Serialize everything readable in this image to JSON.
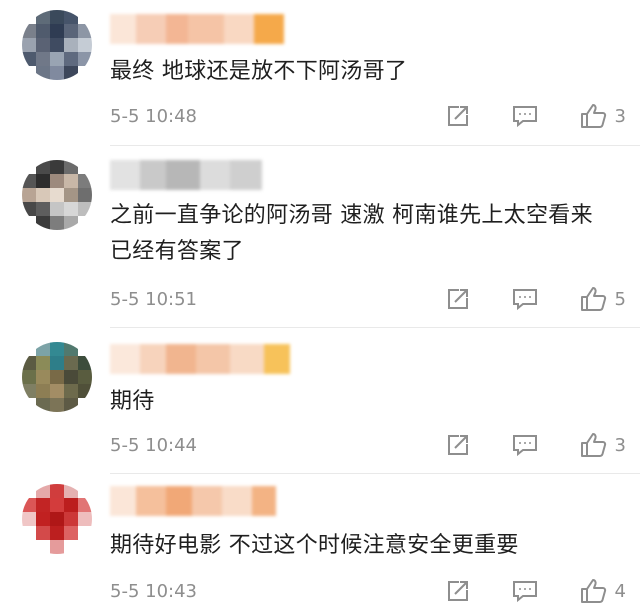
{
  "comments": [
    {
      "text": "最终 地球还是放不下阿汤哥了",
      "time": "5-5 10:48",
      "likes": "3",
      "avatar_colors": [
        "#ffffff",
        "#5d6b79",
        "#39495c",
        "#45546b",
        "#ffffff",
        "#7a808c",
        "#4f5b6e",
        "#2e3c54",
        "#59657a",
        "#8d96a6",
        "#9aa2b0",
        "#5a6275",
        "#3e4b62",
        "#a9b1bd",
        "#c5ccd5",
        "#4d5a6f",
        "#707889",
        "#99a4b4",
        "#5e6a80",
        "#8a95a8",
        "#ffffff",
        "#6c7688",
        "#7f8aa0",
        "#3d475c",
        "#ffffff"
      ],
      "name_colors": [
        "#fbe6d8",
        "#f6cdb6",
        "#f3b694",
        "#f5c4a6",
        "#f9d8c2",
        "#f5a94a"
      ]
    },
    {
      "text": "之前一直争论的阿汤哥 速激 柯南谁先上太空看来已经有答案了",
      "time": "5-5 10:51",
      "likes": "5",
      "avatar_colors": [
        "#ffffff",
        "#4a4a4a",
        "#3a3a3a",
        "#6b6b6b",
        "#ffffff",
        "#555555",
        "#2d2d2d",
        "#9e8a7c",
        "#c9b7a6",
        "#7c7c7c",
        "#b9a493",
        "#d9c8b7",
        "#e8dbce",
        "#a59585",
        "#6e6e6e",
        "#484848",
        "#5e5e5e",
        "#c5c5c5",
        "#d7d7d7",
        "#bdbdbd",
        "#ffffff",
        "#3b3b3b",
        "#7d7d7d",
        "#a9a9a9",
        "#ffffff"
      ],
      "name_colors": [
        "#e2e2e2",
        "#c9c9c9",
        "#b7b7b7",
        "#dcdcdc",
        "#cfcfcf"
      ]
    },
    {
      "text": "期待",
      "time": "5-5 10:44",
      "likes": "3",
      "avatar_colors": [
        "#ffffff",
        "#7aa3a8",
        "#2f8a93",
        "#4f7a6e",
        "#ffffff",
        "#5b5b42",
        "#8b8b55",
        "#2b7f8a",
        "#6a6a4e",
        "#3c4d3b",
        "#6b7048",
        "#9a8a5a",
        "#7a6a45",
        "#4a4a38",
        "#595c3e",
        "#7f7f62",
        "#8e7e52",
        "#a48d63",
        "#6d6a4a",
        "#505038",
        "#ffffff",
        "#6b6a50",
        "#7c7456",
        "#5d5a44",
        "#ffffff"
      ],
      "name_colors": [
        "#fbe8db",
        "#f7d3bc",
        "#f1b58f",
        "#f4c6a8",
        "#f8dac5",
        "#f7c25a"
      ]
    },
    {
      "text": "期待好电影 不过这个时候注意安全更重要",
      "time": "5-5 10:43",
      "likes": "4",
      "avatar_colors": [
        "#ffffff",
        "#e8a8a8",
        "#d63b3b",
        "#e7b0b0",
        "#ffffff",
        "#e05555",
        "#c92222",
        "#d93a3a",
        "#c31c1c",
        "#e57474",
        "#f2c6c6",
        "#c81f1f",
        "#b51515",
        "#d23636",
        "#f0bcbc",
        "#ffffff",
        "#d94848",
        "#c21d1d",
        "#e26262",
        "#ffffff",
        "#ffffff",
        "#ffffff",
        "#e89a9a",
        "#ffffff",
        "#ffffff"
      ],
      "name_colors": [
        "#fbe6d8",
        "#f5c09c",
        "#f1a877",
        "#f5c8ab",
        "#f9dcc8",
        "#f3b384"
      ]
    }
  ],
  "icons": {
    "share": "share-icon",
    "reply": "comment-icon",
    "like": "thumbs-up-icon"
  }
}
